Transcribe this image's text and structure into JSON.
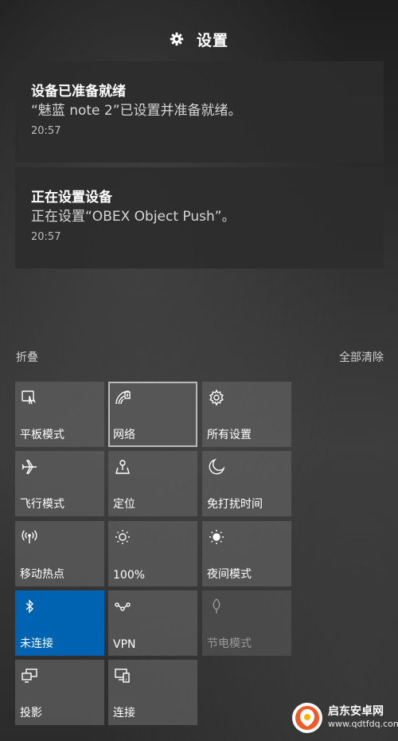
{
  "header": {
    "icon": "gear-icon",
    "title": "设置"
  },
  "notifications": [
    {
      "title": "设备已准备就绪",
      "body": "“魅蓝 note 2”已设置并准备就绪。",
      "time": "20:57"
    },
    {
      "title": "正在设置设备",
      "body": "正在设置“OBEX Object Push”。",
      "time": "20:57"
    }
  ],
  "actions": {
    "collapse": "折叠",
    "clear_all": "全部清除"
  },
  "tiles": [
    {
      "label": "平板模式",
      "icon": "tablet-mode-icon",
      "state": "normal"
    },
    {
      "label": "网络",
      "icon": "network-icon",
      "state": "selected"
    },
    {
      "label": "所有设置",
      "icon": "settings-gear-icon",
      "state": "normal"
    },
    {
      "label": "飞行模式",
      "icon": "airplane-icon",
      "state": "normal"
    },
    {
      "label": "定位",
      "icon": "location-icon",
      "state": "normal"
    },
    {
      "label": "免打扰时间",
      "icon": "moon-icon",
      "state": "normal"
    },
    {
      "label": "移动热点",
      "icon": "hotspot-icon",
      "state": "normal"
    },
    {
      "label": "100%",
      "icon": "brightness-icon",
      "state": "normal"
    },
    {
      "label": "夜间模式",
      "icon": "night-light-icon",
      "state": "normal"
    },
    {
      "label": "未连接",
      "icon": "bluetooth-icon",
      "state": "active"
    },
    {
      "label": "VPN",
      "icon": "vpn-icon",
      "state": "normal"
    },
    {
      "label": "节电模式",
      "icon": "battery-saver-icon",
      "state": "disabled"
    },
    {
      "label": "投影",
      "icon": "project-icon",
      "state": "normal"
    },
    {
      "label": "连接",
      "icon": "connect-icon",
      "state": "normal"
    }
  ],
  "watermark": {
    "name": "启东安卓网",
    "url": "www.qdtfdq.com"
  },
  "colors": {
    "accent": "#0063b1",
    "tile": "#5c5c5c",
    "notification_bg": "#2c2c2c"
  }
}
